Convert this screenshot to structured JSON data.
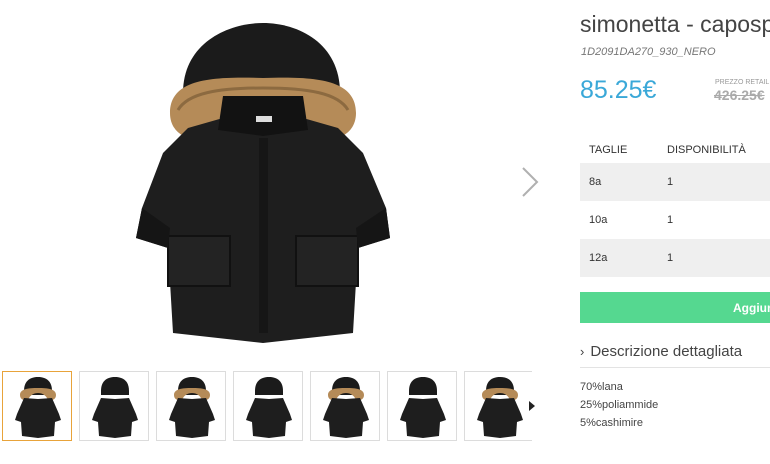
{
  "product": {
    "title": "simonetta - capospalla",
    "sku": "1D2091DA270_930_NERO",
    "price": "85.25€",
    "retail_label": "PREZZO RETAIL",
    "retail_price": "426.25€"
  },
  "sizes": {
    "header_size": "TAGLIE",
    "header_availability": "DISPONIBILITÀ",
    "rows": [
      {
        "size": "8a",
        "qty": "1"
      },
      {
        "size": "10a",
        "qty": "1"
      },
      {
        "size": "12a",
        "qty": "1"
      }
    ]
  },
  "actions": {
    "add_label": "Aggiungi al carrello"
  },
  "description": {
    "toggle_label": "Descrizione dettagliata",
    "lines": [
      "70%lana",
      "25%poliammide",
      "5%cashimire"
    ]
  },
  "gallery": {
    "thumbnail_count": 7,
    "selected_index": 0
  },
  "colors": {
    "price": "#3aa8d8",
    "add_button": "#55d890",
    "selected_thumb_border": "#e8a33a"
  }
}
